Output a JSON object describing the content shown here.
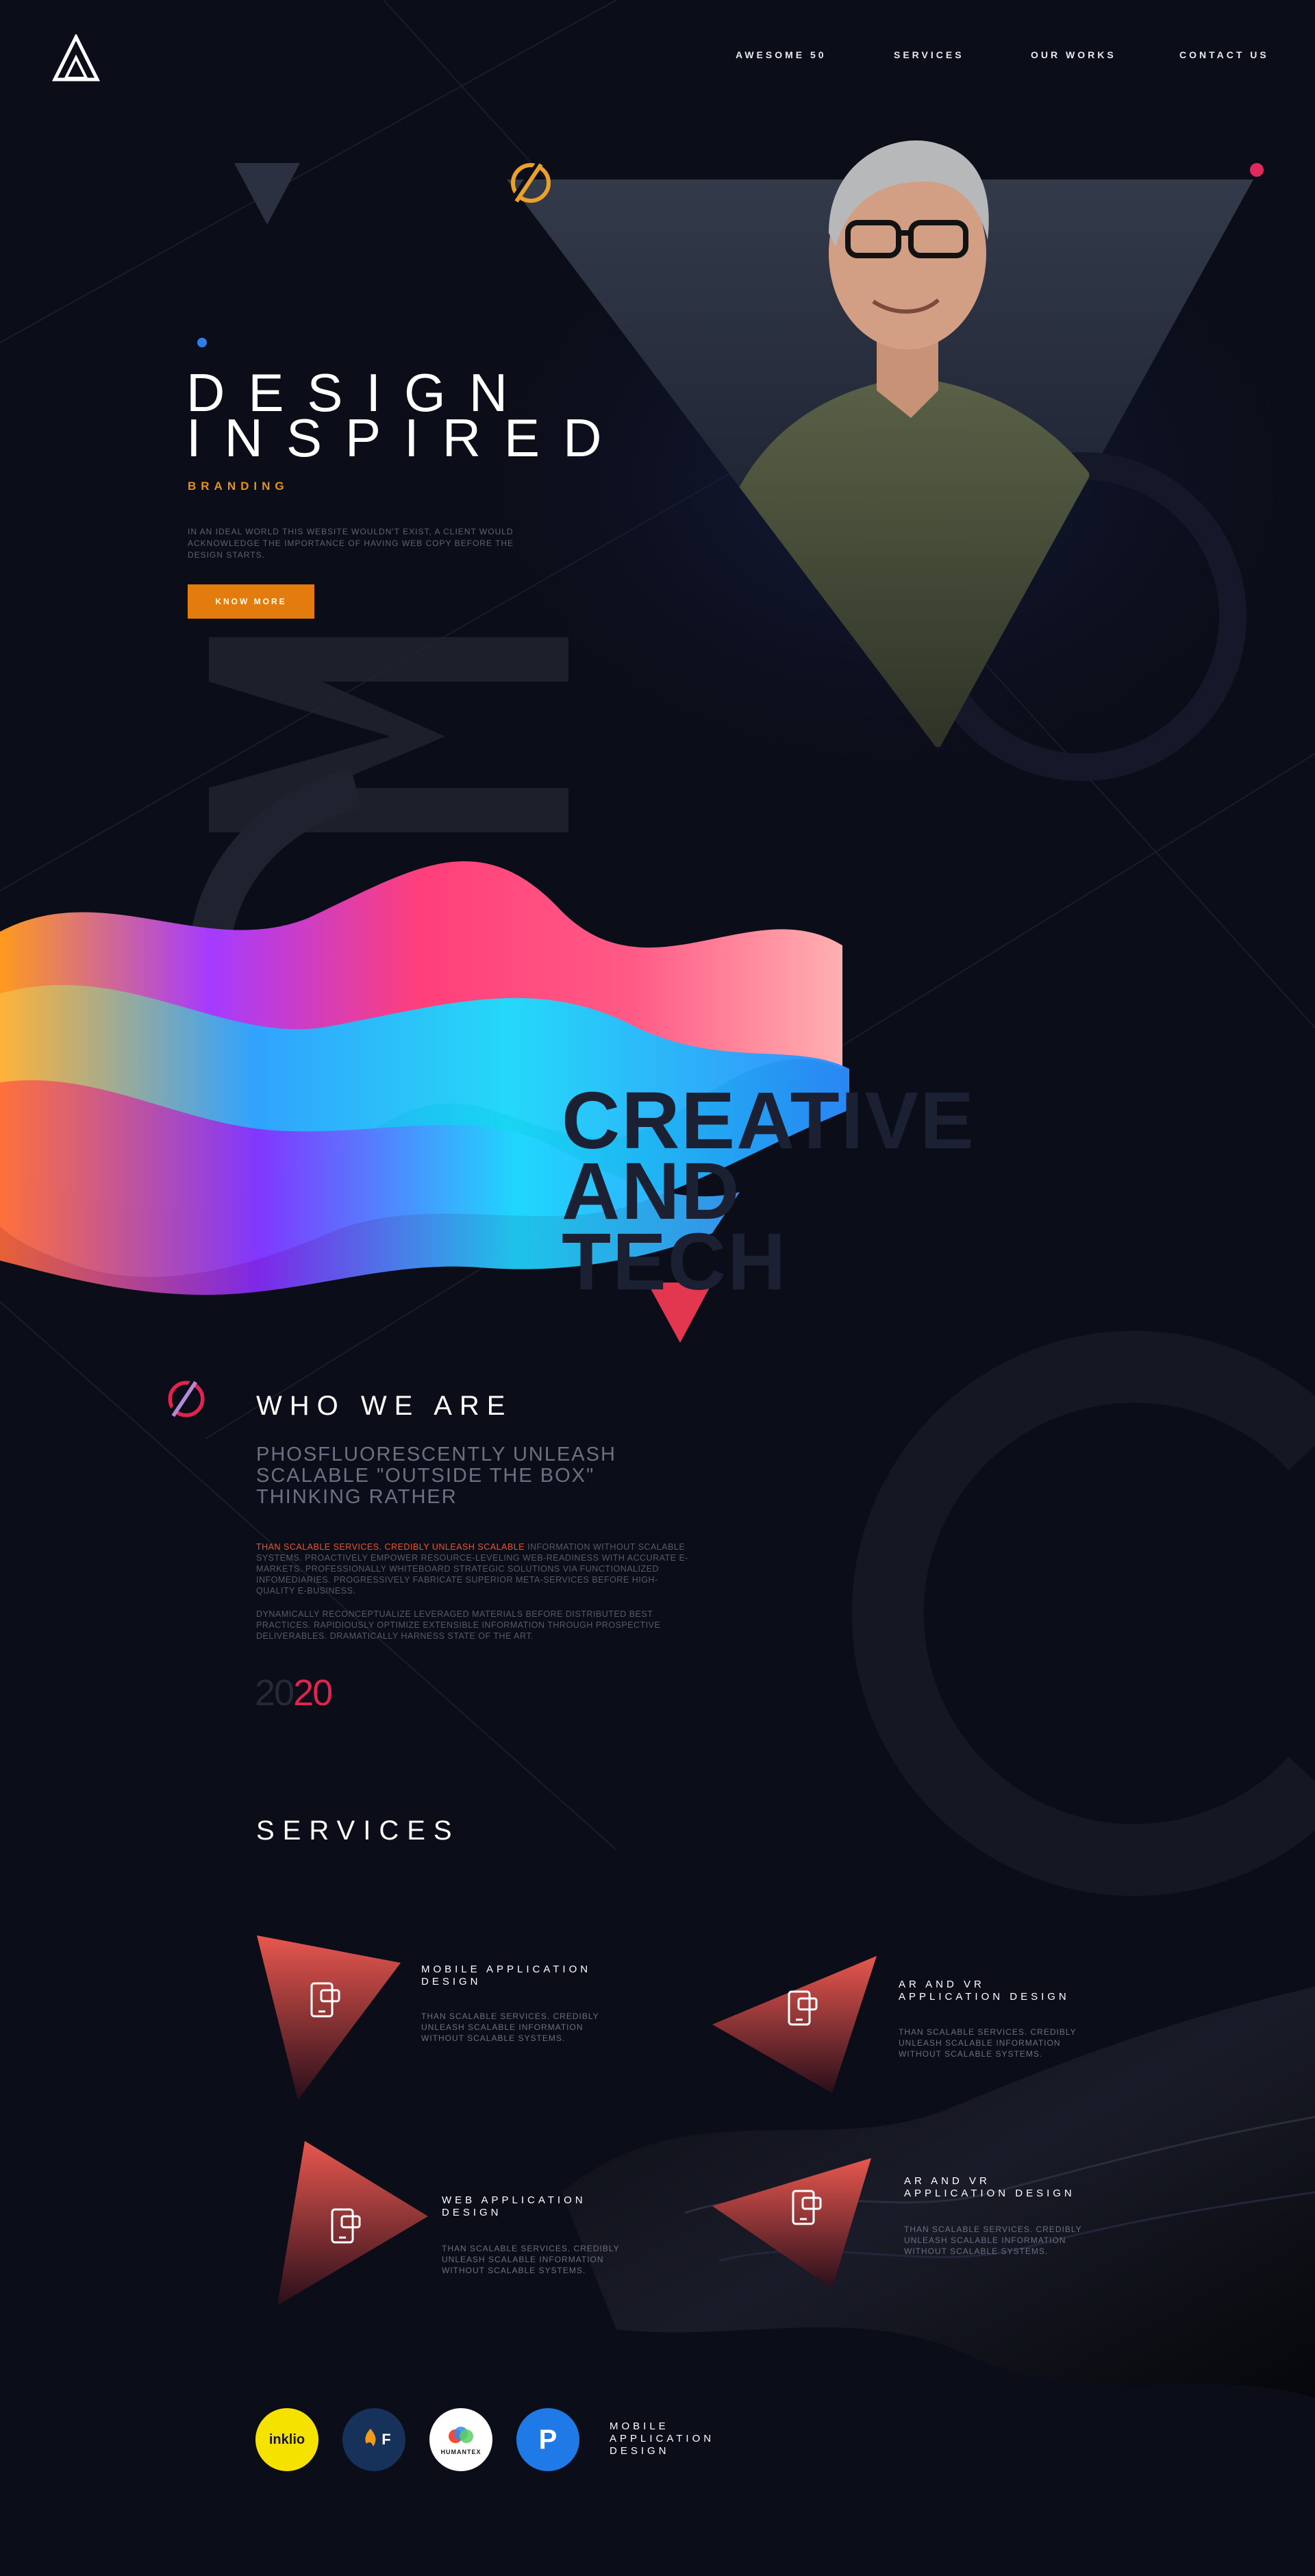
{
  "nav": {
    "logo": "brand-logo",
    "items": [
      {
        "label": "AWESOME 50"
      },
      {
        "label": "SERVICES"
      },
      {
        "label": "OUR WORKS"
      },
      {
        "label": "CONTACT US"
      }
    ]
  },
  "hero": {
    "title_line1": "DESIGN",
    "title_line2": "INSPIRED",
    "subtitle": "BRANDING",
    "description": "IN AN IDEAL WORLD THIS WEBSITE WOULDN'T EXIST, A CLIENT WOULD ACKNOWLEDGE THE IMPORTANCE OF HAVING WEB COPY BEFORE THE DESIGN STARTS.",
    "cta": "KNOW MORE"
  },
  "creative": {
    "line1": "CREATIVE",
    "line2": "AND",
    "line3": "TECH"
  },
  "who": {
    "title": "WHO WE ARE",
    "lead": "PHOSFLUORESCENTLY UNLEASH SCALABLE \"OUTSIDE THE BOX\" THINKING RATHER",
    "para1_highlight": "THAN SCALABLE SERVICES. CREDIBLY UNLEASH SCALABLE",
    "para1_rest": " INFORMATION WITHOUT SCALABLE SYSTEMS. PROACTIVELY EMPOWER RESOURCE-LEVELING WEB-READINESS WITH ACCURATE E-MARKETS. PROFESSIONALLY WHITEBOARD STRATEGIC SOLUTIONS VIA FUNCTIONALIZED INFOMEDIARIES. PROGRESSIVELY FABRICATE SUPERIOR META-SERVICES BEFORE HIGH-QUALITY E-BUSINESS.",
    "para2": "DYNAMICALLY RECONCEPTUALIZE LEVERAGED MATERIALS BEFORE DISTRIBUTED BEST PRACTICES. RAPIDIOUSLY OPTIMIZE EXTENSIBLE INFORMATION THROUGH PROSPECTIVE DELIVERABLES. DRAMATICALLY HARNESS STATE OF THE ART.",
    "year_part1": "20",
    "year_part2": "20"
  },
  "services": {
    "title": "SERVICES",
    "items": [
      {
        "title": "MOBILE APPLICATION DESIGN",
        "desc": "THAN SCALABLE SERVICES. CREDIBLY UNLEASH SCALABLE INFORMATION WITHOUT SCALABLE SYSTEMS.",
        "icon": "mobile-chat-icon"
      },
      {
        "title": "AR AND VR APPLICATION DESIGN",
        "desc": "THAN SCALABLE SERVICES. CREDIBLY UNLEASH SCALABLE INFORMATION WITHOUT SCALABLE SYSTEMS.",
        "icon": "mobile-chat-icon"
      },
      {
        "title": "WEB APPLICATION DESIGN",
        "desc": "THAN SCALABLE SERVICES. CREDIBLY UNLEASH SCALABLE INFORMATION WITHOUT SCALABLE SYSTEMS.",
        "icon": "mobile-chat-icon"
      },
      {
        "title": "AR AND VR APPLICATION DESIGN",
        "desc": "THAN SCALABLE SERVICES. CREDIBLY UNLEASH SCALABLE INFORMATION WITHOUT SCALABLE SYSTEMS.",
        "icon": "mobile-chat-icon"
      }
    ]
  },
  "clients": {
    "logos": [
      {
        "name": "inklio",
        "text": "inklio"
      },
      {
        "name": "fx-logo",
        "text": "F"
      },
      {
        "name": "humantex",
        "text": "HUMANTEX"
      },
      {
        "name": "p-logo",
        "text": "P"
      }
    ],
    "label": "MOBILE APPLICATION DESIGN"
  },
  "colors": {
    "background": "#0b0d18",
    "accent_orange": "#e47c0d",
    "accent_red": "#e1244d",
    "service_gradient_top": "#e8574f",
    "service_gradient_bottom": "#3a1220"
  }
}
